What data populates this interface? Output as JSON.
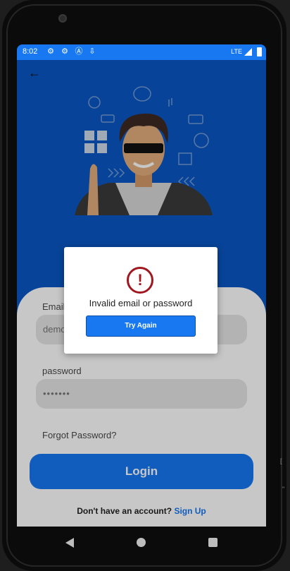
{
  "status_bar": {
    "time": "8:02",
    "icons": [
      "gear-icon",
      "gear-icon",
      "a-circle-icon",
      "download-icon"
    ],
    "network": "LTE"
  },
  "header": {
    "back_icon": "arrow-left-icon"
  },
  "form": {
    "email_label": "Email",
    "email_value": "demo",
    "password_label": "password",
    "password_value": "•••••••",
    "forgot_link": "Forgot Password?",
    "login_button": "Login",
    "signup_prompt": "Don't have an account?",
    "signup_link": "Sign Up"
  },
  "dialog": {
    "icon": "exclamation-circle-icon",
    "message": "Invalid email or password",
    "button": "Try Again"
  },
  "colors": {
    "primary": "#1778f2",
    "header_bg": "#0a58c4",
    "alert": "#a0171f"
  }
}
